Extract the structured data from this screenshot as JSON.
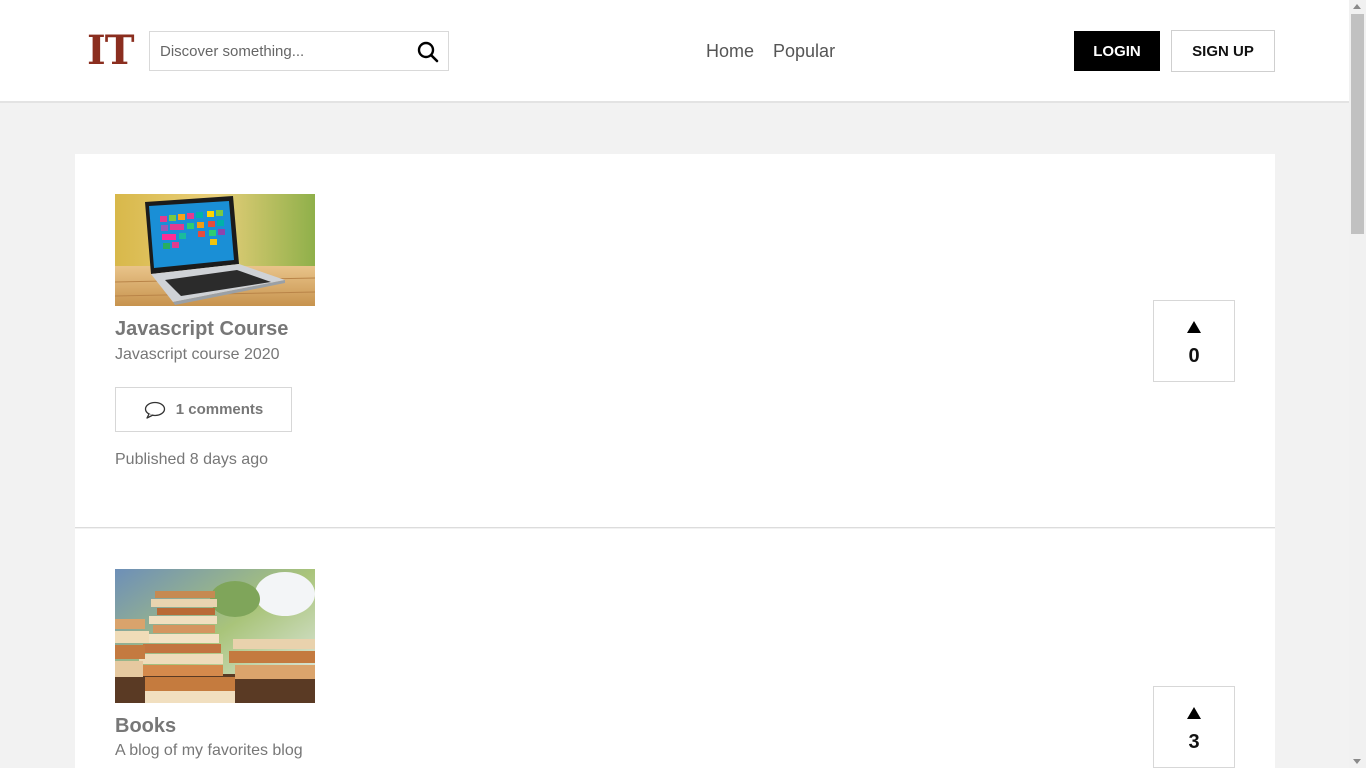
{
  "header": {
    "logo": "IT",
    "search": {
      "placeholder": "Discover something...",
      "value": ""
    },
    "nav": [
      "Home",
      "Popular"
    ],
    "login_label": "LOGIN",
    "signup_label": "SIGN UP"
  },
  "posts": [
    {
      "title": "Javascript Course",
      "description": "Javascript course 2020",
      "comments_label": "1 comments",
      "published": "Published 8 days ago",
      "votes": "0",
      "thumbnail": "laptop-photo"
    },
    {
      "title": "Books",
      "description": "A blog of my favorites blog",
      "votes": "3",
      "thumbnail": "books-photo"
    }
  ],
  "colors": {
    "logo": "#8b2e1f",
    "page_bg": "#f2f2f2",
    "login_bg": "#000000"
  }
}
